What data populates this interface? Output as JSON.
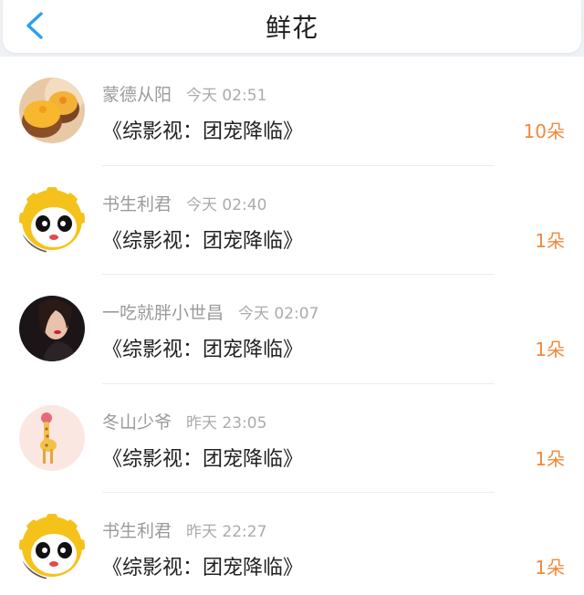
{
  "header": {
    "title": "鲜花",
    "back_icon": "chevron-left-icon",
    "accent_color": "#2a9ff0"
  },
  "flowers": [
    {
      "user": "蒙德从阳",
      "time": "今天 02:51",
      "book": "《综影视：团宠降临》",
      "count": "10朵",
      "avatar": "cake-avatar"
    },
    {
      "user": "书生利君",
      "time": "今天 02:40",
      "book": "《综影视：团宠降临》",
      "count": "1朵",
      "avatar": "panda-sun-avatar"
    },
    {
      "user": "一吃就胖小世昌",
      "time": "今天 02:07",
      "book": "《综影视：团宠降临》",
      "count": "1朵",
      "avatar": "portrait-avatar"
    },
    {
      "user": "冬山少爷",
      "time": "昨天 23:05",
      "book": "《综影视：团宠降临》",
      "count": "1朵",
      "avatar": "giraffe-avatar"
    },
    {
      "user": "书生利君",
      "time": "昨天 22:27",
      "book": "《综影视：团宠降临》",
      "count": "1朵",
      "avatar": "panda-sun-avatar"
    }
  ],
  "colors": {
    "count": "#f0893a",
    "name": "#9a9a9a",
    "title": "#222222"
  }
}
